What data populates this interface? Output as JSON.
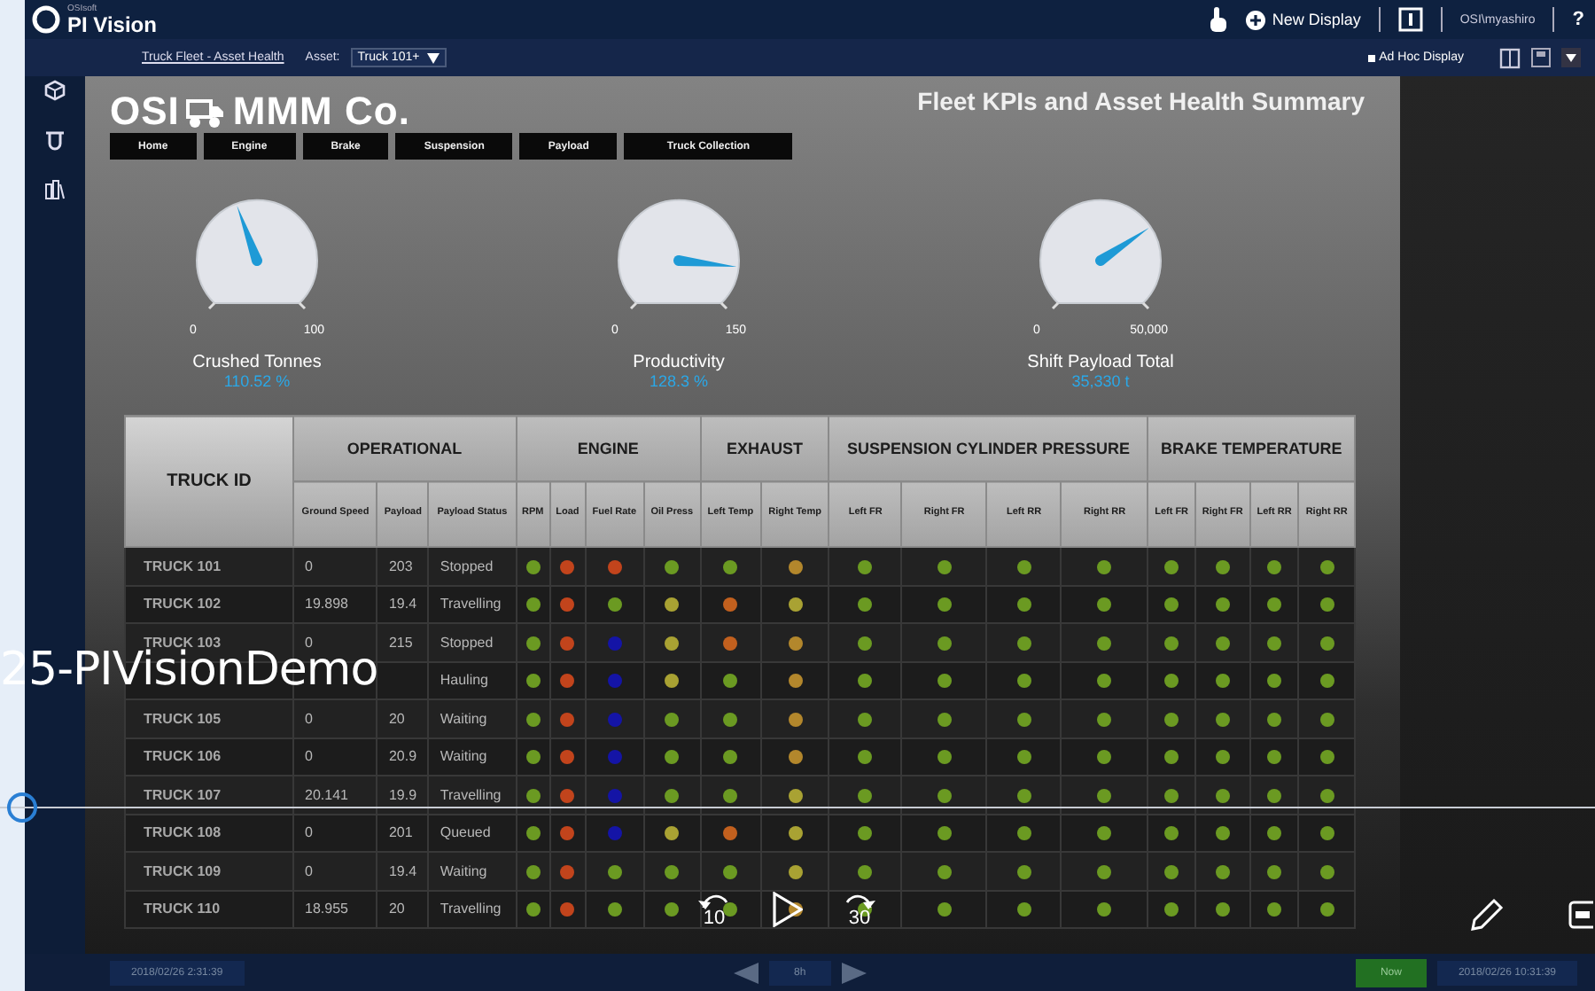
{
  "app": {
    "vendor": "OSIsoft",
    "title": "PI Vision",
    "new_display": "New Display",
    "user": "OSI\\myashiro",
    "help": "?"
  },
  "toolbar": {
    "breadcrumb": "Truck Fleet - Asset Health",
    "asset_label": "Asset:",
    "asset_value": "Truck 101+",
    "ad_hoc": "Ad Hoc Display"
  },
  "display": {
    "company": "OSI",
    "company_suffix": "MMM Co.",
    "title": "Fleet KPIs and Asset Health Summary",
    "nav": [
      {
        "label": "Home"
      },
      {
        "label": "Engine"
      },
      {
        "label": "Brake"
      },
      {
        "label": "Suspension"
      },
      {
        "label": "Payload"
      },
      {
        "label": "Truck Collection"
      }
    ],
    "gauges": [
      {
        "label": "Crushed Tonnes",
        "min": "0",
        "max": "100",
        "value": "110.52 %"
      },
      {
        "label": "Productivity",
        "min": "0",
        "max": "150",
        "value": "128.3 %"
      },
      {
        "label": "Shift Payload Total",
        "min": "0",
        "max": "50,000",
        "value": "35,330 t"
      }
    ],
    "table": {
      "id_header": "TRUCK ID",
      "groups": [
        {
          "label": "OPERATIONAL",
          "columns": [
            "Ground Speed",
            "Payload",
            "Payload Status"
          ]
        },
        {
          "label": "ENGINE",
          "columns": [
            "RPM",
            "Load",
            "Fuel Rate",
            "Oil Press"
          ]
        },
        {
          "label": "EXHAUST",
          "columns": [
            "Left Temp",
            "Right Temp"
          ]
        },
        {
          "label": "SUSPENSION CYLINDER PRESSURE",
          "columns": [
            "Left FR",
            "Right FR",
            "Left RR",
            "Right RR"
          ]
        },
        {
          "label": "BRAKE TEMPERATURE",
          "columns": [
            "Left FR",
            "Right FR",
            "Left RR",
            "Right RR"
          ]
        }
      ],
      "rows": [
        {
          "id": "TRUCK 101",
          "ground_speed": "0",
          "payload": "203",
          "status": "Stopped",
          "indicators": [
            {
              "color": "#6b9a22"
            },
            {
              "color": "#c2441c"
            },
            {
              "color": "#c2441c"
            },
            {
              "color": "#6b9a22"
            },
            {
              "color": "#6b9a22"
            },
            {
              "color": "#b3872c"
            },
            {
              "color": "#6b9a22"
            },
            {
              "color": "#6b9a22"
            },
            {
              "color": "#6b9a22"
            },
            {
              "color": "#6b9a22"
            },
            {
              "color": "#6b9a22"
            },
            {
              "color": "#6b9a22"
            },
            {
              "color": "#6b9a22"
            },
            {
              "color": "#6b9a22"
            }
          ]
        },
        {
          "id": "TRUCK 102",
          "ground_speed": "19.898",
          "payload": "19.4",
          "status": "Travelling",
          "indicators": [
            {
              "color": "#6b9a22"
            },
            {
              "color": "#c2441c"
            },
            {
              "color": "#6b9a22"
            },
            {
              "color": "#a9a233"
            },
            {
              "color": "#c2601e"
            },
            {
              "color": "#a9a233"
            },
            {
              "color": "#6b9a22"
            },
            {
              "color": "#6b9a22"
            },
            {
              "color": "#6b9a22"
            },
            {
              "color": "#6b9a22"
            },
            {
              "color": "#6b9a22"
            },
            {
              "color": "#6b9a22"
            },
            {
              "color": "#6b9a22"
            },
            {
              "color": "#6b9a22"
            }
          ]
        },
        {
          "id": "TRUCK 103",
          "ground_speed": "0",
          "payload": "215",
          "status": "Stopped",
          "indicators": [
            {
              "color": "#6b9a22"
            },
            {
              "color": "#c2441c"
            },
            {
              "color": "#1414a6"
            },
            {
              "color": "#a9a233"
            },
            {
              "color": "#c2601e"
            },
            {
              "color": "#b3872c"
            },
            {
              "color": "#6b9a22"
            },
            {
              "color": "#6b9a22"
            },
            {
              "color": "#6b9a22"
            },
            {
              "color": "#6b9a22"
            },
            {
              "color": "#6b9a22"
            },
            {
              "color": "#6b9a22"
            },
            {
              "color": "#6b9a22"
            },
            {
              "color": "#6b9a22"
            }
          ]
        },
        {
          "status": "Hauling",
          "indicators": [
            {
              "color": "#6b9a22"
            },
            {
              "color": "#c2441c"
            },
            {
              "color": "#1414a6"
            },
            {
              "color": "#a9a233"
            },
            {
              "color": "#6b9a22"
            },
            {
              "color": "#b3872c"
            },
            {
              "color": "#6b9a22"
            },
            {
              "color": "#6b9a22"
            },
            {
              "color": "#6b9a22"
            },
            {
              "color": "#6b9a22"
            },
            {
              "color": "#6b9a22"
            },
            {
              "color": "#6b9a22"
            },
            {
              "color": "#6b9a22"
            },
            {
              "color": "#6b9a22"
            }
          ]
        },
        {
          "id": "TRUCK 105",
          "ground_speed": "0",
          "payload": "20",
          "status": "Waiting",
          "indicators": [
            {
              "color": "#6b9a22"
            },
            {
              "color": "#c2441c"
            },
            {
              "color": "#1414a6"
            },
            {
              "color": "#6b9a22"
            },
            {
              "color": "#6b9a22"
            },
            {
              "color": "#b3872c"
            },
            {
              "color": "#6b9a22"
            },
            {
              "color": "#6b9a22"
            },
            {
              "color": "#6b9a22"
            },
            {
              "color": "#6b9a22"
            },
            {
              "color": "#6b9a22"
            },
            {
              "color": "#6b9a22"
            },
            {
              "color": "#6b9a22"
            },
            {
              "color": "#6b9a22"
            }
          ]
        },
        {
          "id": "TRUCK 106",
          "ground_speed": "0",
          "payload": "20.9",
          "status": "Waiting",
          "indicators": [
            {
              "color": "#6b9a22"
            },
            {
              "color": "#c2441c"
            },
            {
              "color": "#1414a6"
            },
            {
              "color": "#6b9a22"
            },
            {
              "color": "#6b9a22"
            },
            {
              "color": "#b3872c"
            },
            {
              "color": "#6b9a22"
            },
            {
              "color": "#6b9a22"
            },
            {
              "color": "#6b9a22"
            },
            {
              "color": "#6b9a22"
            },
            {
              "color": "#6b9a22"
            },
            {
              "color": "#6b9a22"
            },
            {
              "color": "#6b9a22"
            },
            {
              "color": "#6b9a22"
            }
          ]
        },
        {
          "id": "TRUCK 107",
          "ground_speed": "20.141",
          "payload": "19.9",
          "status": "Travelling",
          "indicators": [
            {
              "color": "#6b9a22"
            },
            {
              "color": "#c2441c"
            },
            {
              "color": "#1414a6"
            },
            {
              "color": "#6b9a22"
            },
            {
              "color": "#6b9a22"
            },
            {
              "color": "#a9a233"
            },
            {
              "color": "#6b9a22"
            },
            {
              "color": "#6b9a22"
            },
            {
              "color": "#6b9a22"
            },
            {
              "color": "#6b9a22"
            },
            {
              "color": "#6b9a22"
            },
            {
              "color": "#6b9a22"
            },
            {
              "color": "#6b9a22"
            },
            {
              "color": "#6b9a22"
            }
          ]
        },
        {
          "id": "TRUCK 108",
          "ground_speed": "0",
          "payload": "201",
          "status": "Queued",
          "indicators": [
            {
              "color": "#6b9a22"
            },
            {
              "color": "#c2441c"
            },
            {
              "color": "#1414a6"
            },
            {
              "color": "#a9a233"
            },
            {
              "color": "#c2601e"
            },
            {
              "color": "#a9a233"
            },
            {
              "color": "#6b9a22"
            },
            {
              "color": "#6b9a22"
            },
            {
              "color": "#6b9a22"
            },
            {
              "color": "#6b9a22"
            },
            {
              "color": "#6b9a22"
            },
            {
              "color": "#6b9a22"
            },
            {
              "color": "#6b9a22"
            },
            {
              "color": "#6b9a22"
            }
          ]
        },
        {
          "id": "TRUCK 109",
          "ground_speed": "0",
          "payload": "19.4",
          "status": "Waiting",
          "indicators": [
            {
              "color": "#6b9a22"
            },
            {
              "color": "#c2441c"
            },
            {
              "color": "#6b9a22"
            },
            {
              "color": "#6b9a22"
            },
            {
              "color": "#6b9a22"
            },
            {
              "color": "#a9a233"
            },
            {
              "color": "#6b9a22"
            },
            {
              "color": "#6b9a22"
            },
            {
              "color": "#6b9a22"
            },
            {
              "color": "#6b9a22"
            },
            {
              "color": "#6b9a22"
            },
            {
              "color": "#6b9a22"
            },
            {
              "color": "#6b9a22"
            },
            {
              "color": "#6b9a22"
            }
          ]
        },
        {
          "id": "TRUCK 110",
          "ground_speed": "18.955",
          "payload": "20",
          "status": "Travelling",
          "indicators": [
            {
              "color": "#6b9a22"
            },
            {
              "color": "#c2441c"
            },
            {
              "color": "#6b9a22"
            },
            {
              "color": "#6b9a22"
            },
            {
              "color": "#6b9a22"
            },
            {
              "color": "#b3872c"
            },
            {
              "color": "#6b9a22"
            },
            {
              "color": "#6b9a22"
            },
            {
              "color": "#6b9a22"
            },
            {
              "color": "#6b9a22"
            },
            {
              "color": "#6b9a22"
            },
            {
              "color": "#6b9a22"
            },
            {
              "color": "#6b9a22"
            },
            {
              "color": "#6b9a22"
            }
          ]
        }
      ]
    }
  },
  "time_bar": {
    "start": "2018/02/26 2:31:39",
    "span": "8h",
    "now": "Now",
    "end": "2018/02/26 10:31:39"
  },
  "video_player": {
    "title": "25-PIVisionDemo",
    "rewind": "10",
    "forward": "30",
    "level": 0
  }
}
